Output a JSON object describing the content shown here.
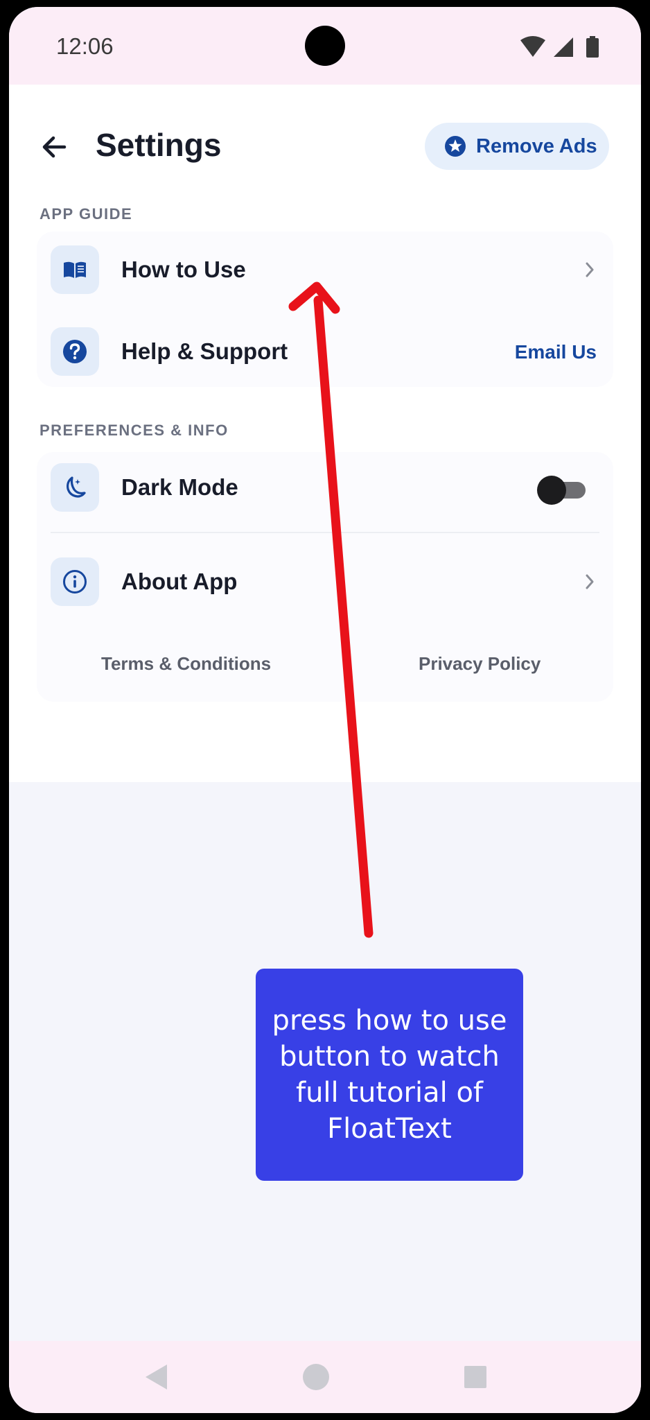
{
  "status_bar": {
    "time": "12:06",
    "icons": [
      "wifi-icon",
      "signal-icon",
      "battery-icon"
    ]
  },
  "header": {
    "title": "Settings",
    "back_icon": "arrow-left-icon",
    "remove_ads_label": "Remove Ads",
    "remove_ads_icon": "star-badge-icon"
  },
  "sections": {
    "app_guide_label": "APP GUIDE",
    "preferences_label": "PREFERENCES & INFO"
  },
  "app_guide": {
    "how_to_use": "How to Use",
    "help_support": "Help & Support",
    "email_us": "Email Us"
  },
  "preferences": {
    "dark_mode": "Dark Mode",
    "dark_mode_enabled": false,
    "about_app": "About App",
    "terms": "Terms & Conditions",
    "privacy": "Privacy Policy"
  },
  "annotation": {
    "tooltip_text": "press how to use button to watch full tutorial of FloatText",
    "color": "#3840e6",
    "arrow_color": "#e8121a"
  },
  "nav_bar": {
    "icons": [
      "back-triangle-icon",
      "home-circle-icon",
      "recents-square-icon"
    ]
  },
  "colors": {
    "accent": "#16479e",
    "status_bar_bg": "#fcedf7"
  }
}
